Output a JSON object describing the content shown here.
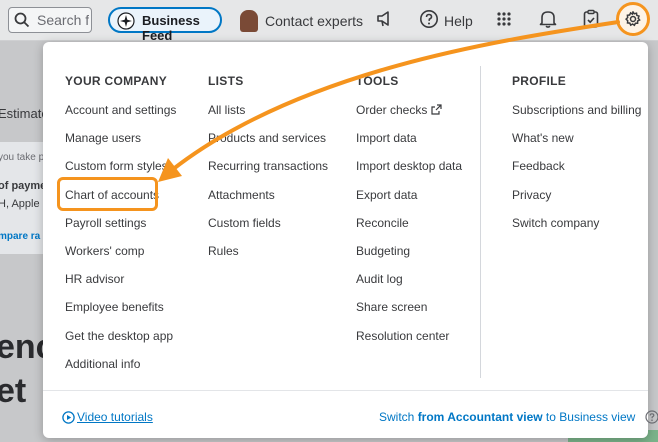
{
  "topbar": {
    "search_placeholder": "Search fo",
    "business_feed_label": "Business Feed",
    "contact_experts_label": "Contact experts",
    "help_label": "Help"
  },
  "background": {
    "estimates_tab": "Estimate",
    "card_line1": "you take p",
    "card_title": "of payme",
    "card_sub": "H, Apple",
    "card_link": "mpare ra",
    "heading_line1": "enc",
    "heading_line2": "et"
  },
  "menu": {
    "columns": [
      {
        "heading": "YOUR COMPANY",
        "items": [
          "Account and settings",
          "Manage users",
          "Custom form styles",
          "Chart of accounts",
          "Payroll settings",
          "Workers' comp",
          "HR advisor",
          "Employee benefits",
          "Get the desktop app",
          "Additional info"
        ]
      },
      {
        "heading": "LISTS",
        "items": [
          "All lists",
          "Products and services",
          "Recurring transactions",
          "Attachments",
          "Custom fields",
          "Rules"
        ]
      },
      {
        "heading": "TOOLS",
        "items": [
          "Order checks",
          "Import data",
          "Import desktop data",
          "Export data",
          "Reconcile",
          "Budgeting",
          "Audit log",
          "Share screen",
          "Resolution center"
        ]
      },
      {
        "heading": "PROFILE",
        "items": [
          "Subscriptions and billing",
          "What's new",
          "Feedback",
          "Privacy",
          "Switch company"
        ]
      }
    ],
    "footer": {
      "video_tutorials": "Video tutorials",
      "switch_prefix": "Switch ",
      "switch_bold": "from Accountant view",
      "switch_suffix": " to Business view"
    }
  },
  "colors": {
    "accent_orange": "#f5941e",
    "link_blue": "#0077c5"
  }
}
